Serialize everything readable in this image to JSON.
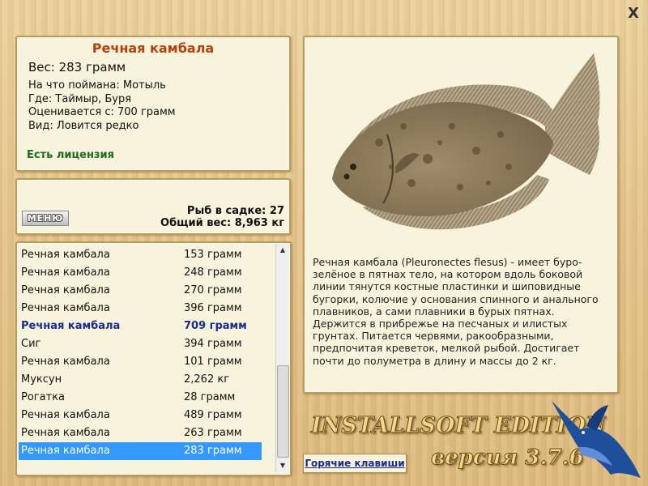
{
  "window": {
    "close_glyph": "X"
  },
  "catch": {
    "name": "Речная камбала",
    "weight": "Вес: 283 грамм",
    "bait": "На что поймана: Мотыль",
    "location": "Где: Таймыр, Буря",
    "value": "Оценивается с: 700 грамм",
    "rarity": "Вид: Ловится редко",
    "license": "Есть лицензия"
  },
  "cage": {
    "menu_label": "МЕНЮ",
    "fish_count": "Рыб в садке: 27",
    "total_weight": "Общий вес: 8,963 кг"
  },
  "list": {
    "items": [
      {
        "name": "Речная камбала",
        "weight": "153 грамм"
      },
      {
        "name": "Речная камбала",
        "weight": "248 грамм"
      },
      {
        "name": "Речная камбала",
        "weight": "270 грамм"
      },
      {
        "name": "Речная камбала",
        "weight": "396 грамм"
      },
      {
        "name": "Речная камбала",
        "weight": "709 грамм",
        "highlight": true
      },
      {
        "name": "Сиг",
        "weight": "394 грамм"
      },
      {
        "name": "Речная камбала",
        "weight": "101 грамм"
      },
      {
        "name": "Муксун",
        "weight": "2,262 кг"
      },
      {
        "name": "Рогатка",
        "weight": "28 грамм"
      },
      {
        "name": "Речная камбала",
        "weight": "489 грамм"
      },
      {
        "name": "Речная камбала",
        "weight": "263 грамм"
      },
      {
        "name": "Речная камбала",
        "weight": "283 грамм",
        "selected": true
      }
    ]
  },
  "fish_info": {
    "description": "Речная камбала (Pleuronectes flesus) - имеет буро-зелёное в пятнах тело, на котором вдоль боковой линии тянутся костные пластинки и шиповидные бугорки, колючие у основания спинного и анального плавников, а сами плавники в бурых пятнах. Держится в прибрежье на песчаных и илистых грунтах. Питается червями, ракообразными, предпочитая креветок, мелкой рыбой. Достигает почти до полуметра в длину и массы до 2 кг."
  },
  "footer": {
    "hotkeys_label": "Горячие клавиши",
    "brand": "INSTALLSOFT EDITION",
    "version": "версия 3.7.6"
  },
  "icons": {
    "close": "close-icon",
    "scroll_up": "arrow-up-icon",
    "scroll_down": "arrow-down-icon",
    "fish": "flounder-image",
    "marlin": "marlin-logo"
  }
}
